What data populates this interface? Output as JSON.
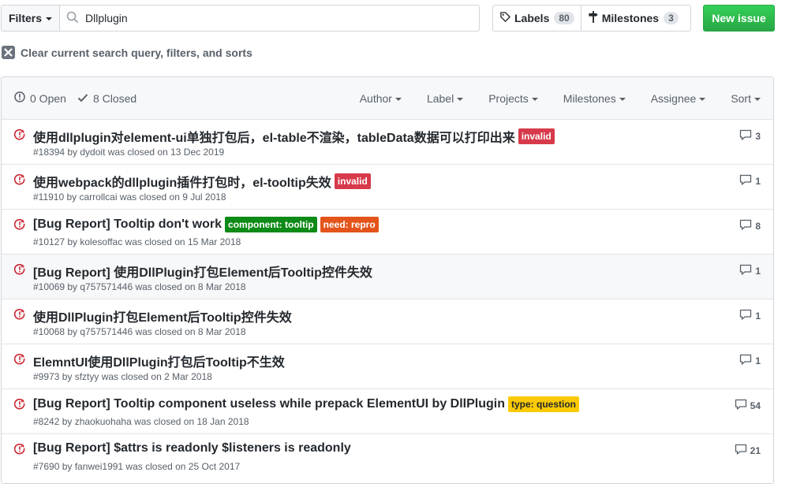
{
  "filters": {
    "button_label": "Filters",
    "search_value": "Dllplugin"
  },
  "labels_button": {
    "label": "Labels",
    "count": "80"
  },
  "milestones_button": {
    "label": "Milestones",
    "count": "3"
  },
  "new_issue_label": "New issue",
  "clear_text": "Clear current search query, filters, and sorts",
  "states": {
    "open": "0 Open",
    "closed": "8 Closed"
  },
  "sort_menus": [
    "Author",
    "Label",
    "Projects",
    "Milestones",
    "Assignee",
    "Sort"
  ],
  "issues": [
    {
      "title": "使用dllplugin对element-ui单独打包后，el-table不渲染，tableData数据可以打印出来",
      "labels": [
        {
          "text": "invalid",
          "color": "#d73a4a"
        }
      ],
      "meta": "#18394 by dydoit was closed on 13 Dec 2019",
      "comments": "3"
    },
    {
      "title": "使用webpack的dllplugin插件打包时，el-tooltip失效",
      "labels": [
        {
          "text": "invalid",
          "color": "#d73a4a"
        }
      ],
      "meta": "#11910 by carrollcai was closed on 9 Jul 2018",
      "comments": "1"
    },
    {
      "title": "[Bug Report] Tooltip don't work",
      "labels": [
        {
          "text": "component: tooltip",
          "color": "#0e8a16"
        },
        {
          "text": "need: repro",
          "color": "#e4541a"
        }
      ],
      "meta": "#10127 by kolesoffac was closed on 15 Mar 2018",
      "comments": "8"
    },
    {
      "title": "[Bug Report] 使用DllPlugin打包Element后Tooltip控件失效",
      "labels": [],
      "meta": "#10069 by q757571446 was closed on 8 Mar 2018",
      "comments": "1"
    },
    {
      "title": "使用DllPlugin打包Element后Tooltip控件失效",
      "labels": [],
      "meta": "#10068 by q757571446 was closed on 8 Mar 2018",
      "comments": "1"
    },
    {
      "title": "ElemntUI使用DllPlugin打包后Tooltip不生效",
      "labels": [],
      "meta": "#9973 by sfztyy was closed on 2 Mar 2018",
      "comments": "1"
    },
    {
      "title": "[Bug Report] Tooltip component useless while prepack ElementUI by DllPlugin",
      "labels": [
        {
          "text": "type: question",
          "color": "#fbca04",
          "text_color": "#24292e"
        }
      ],
      "meta": "#8242 by zhaokuohaha was closed on 18 Jan 2018",
      "comments": "54"
    },
    {
      "title": "[Bug Report] $attrs is readonly $listeners is readonly",
      "labels": [],
      "meta": "#7690 by fanwei1991 was closed on 25 Oct 2017",
      "comments": "21"
    }
  ],
  "colors": {
    "closed_icon": "#cb2431",
    "primary_button": "#28a745",
    "muted_text": "#586069"
  }
}
